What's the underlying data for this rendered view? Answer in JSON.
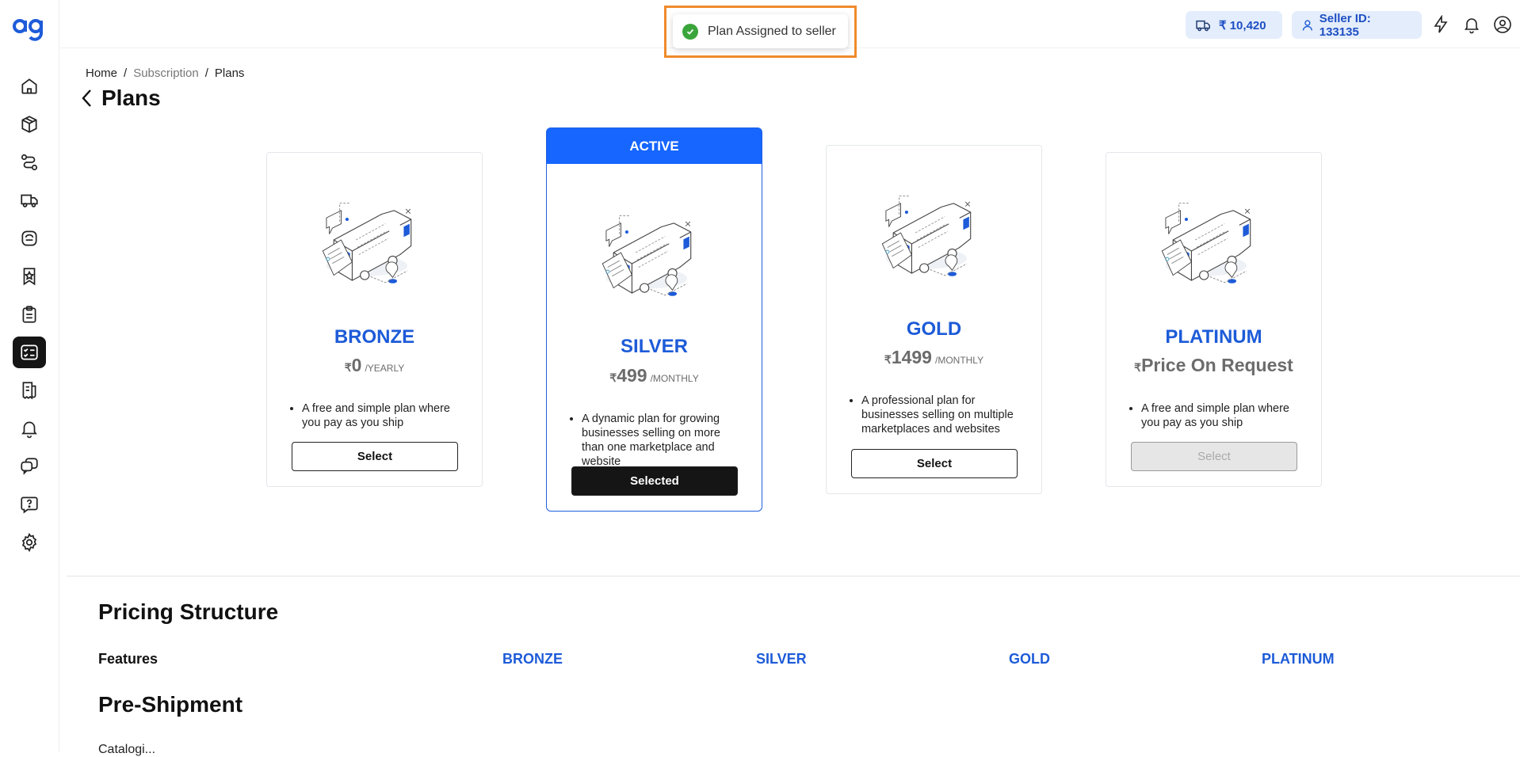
{
  "toast": {
    "message": "Plan Assigned to seller"
  },
  "header": {
    "wallet_balance": "₹ 10,420",
    "seller_id": "Seller ID: 133135"
  },
  "breadcrumb": {
    "home": "Home",
    "sep1": "/",
    "subscription": "Subscription",
    "sep2": "/",
    "current": "Plans"
  },
  "page": {
    "title": "Plans"
  },
  "plans": [
    {
      "name": "BRONZE",
      "currency": "₹",
      "price": "0",
      "period": "/YEARLY",
      "description": "A free and simple plan where you pay as you ship",
      "button": "Select"
    },
    {
      "name": "SILVER",
      "badge": "ACTIVE",
      "currency": "₹",
      "price": "499",
      "period": "/MONTHLY",
      "description": "A dynamic plan for growing businesses selling on more than one marketplace and website",
      "button": "Selected"
    },
    {
      "name": "GOLD",
      "currency": "₹",
      "price": "1499",
      "period": "/MONTHLY",
      "description": "A professional plan for businesses selling on multiple marketplaces and websites",
      "button": "Select"
    },
    {
      "name": "PLATINUM",
      "currency": "₹",
      "price": "Price On Request",
      "period": "",
      "description": "A free and simple plan where you pay as you ship",
      "button": "Select"
    }
  ],
  "pricing": {
    "title": "Pricing Structure",
    "features_label": "Features",
    "columns": [
      "BRONZE",
      "SILVER",
      "GOLD",
      "PLATINUM"
    ],
    "section": "Pre-Shipment",
    "cutoff_text": "Catalogi..."
  },
  "colors": {
    "brand_blue": "#1666ff",
    "plan_name": "#1d5bd8",
    "pill_bg": "#e4edfb",
    "toast_outline": "#f08a2c"
  }
}
